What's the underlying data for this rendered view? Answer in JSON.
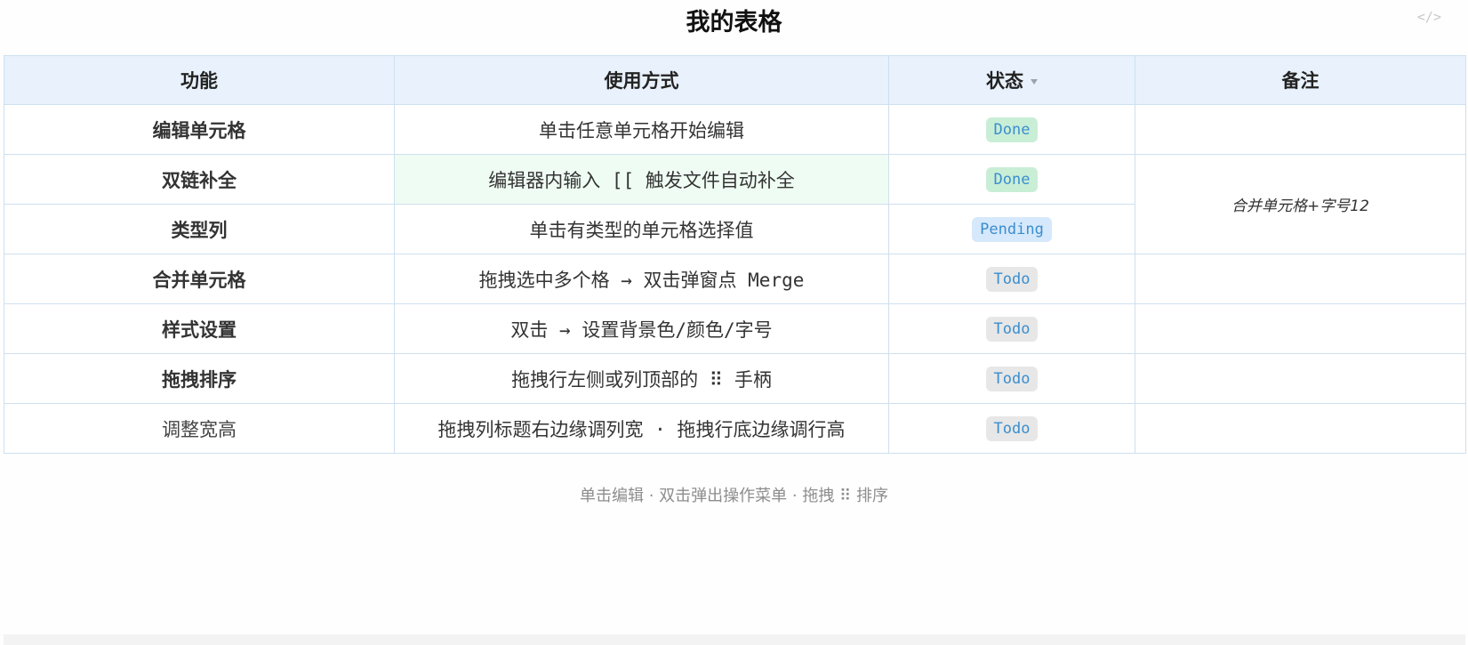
{
  "header": {
    "title": "我的表格",
    "code_toggle": "</>"
  },
  "table": {
    "columns": [
      {
        "label": "功能"
      },
      {
        "label": "使用方式"
      },
      {
        "label": "状态",
        "sortable": true
      },
      {
        "label": "备注"
      }
    ],
    "rows": [
      {
        "feature": "编辑单元格",
        "usage": "单击任意单元格开始编辑",
        "status": "Done"
      },
      {
        "feature": "双链补全",
        "usage": "编辑器内输入 [[ 触发文件自动补全",
        "status": "Done"
      },
      {
        "feature": "类型列",
        "usage": "单击有类型的单元格选择值",
        "status": "Pending"
      },
      {
        "feature": "合并单元格",
        "usage": "拖拽选中多个格 → 双击弹窗点 Merge",
        "status": "Todo"
      },
      {
        "feature": "样式设置",
        "usage": "双击 → 设置背景色/颜色/字号",
        "status": "Todo"
      },
      {
        "feature": "拖拽排序",
        "usage": "拖拽行左侧或列顶部的 ⠿ 手柄",
        "status": "Todo"
      },
      {
        "feature": "调整宽高",
        "usage": "拖拽列标题右边缘调列宽 · 拖拽行底边缘调行高",
        "status": "Todo"
      }
    ],
    "merged_note": "合并单元格+字号12"
  },
  "footer": {
    "hint": "单击编辑 · 双击弹出操作菜单 · 拖拽 ⠿ 排序"
  },
  "colors": {
    "header_bg": "#e8f1fc",
    "highlight_green": "#effcf3",
    "merged_yellow": "#fdf8c4",
    "badge_done": "#c9eed6",
    "badge_pending": "#d6e8fb",
    "badge_todo": "#e7e7e7",
    "badge_text": "#3a8ecf"
  }
}
